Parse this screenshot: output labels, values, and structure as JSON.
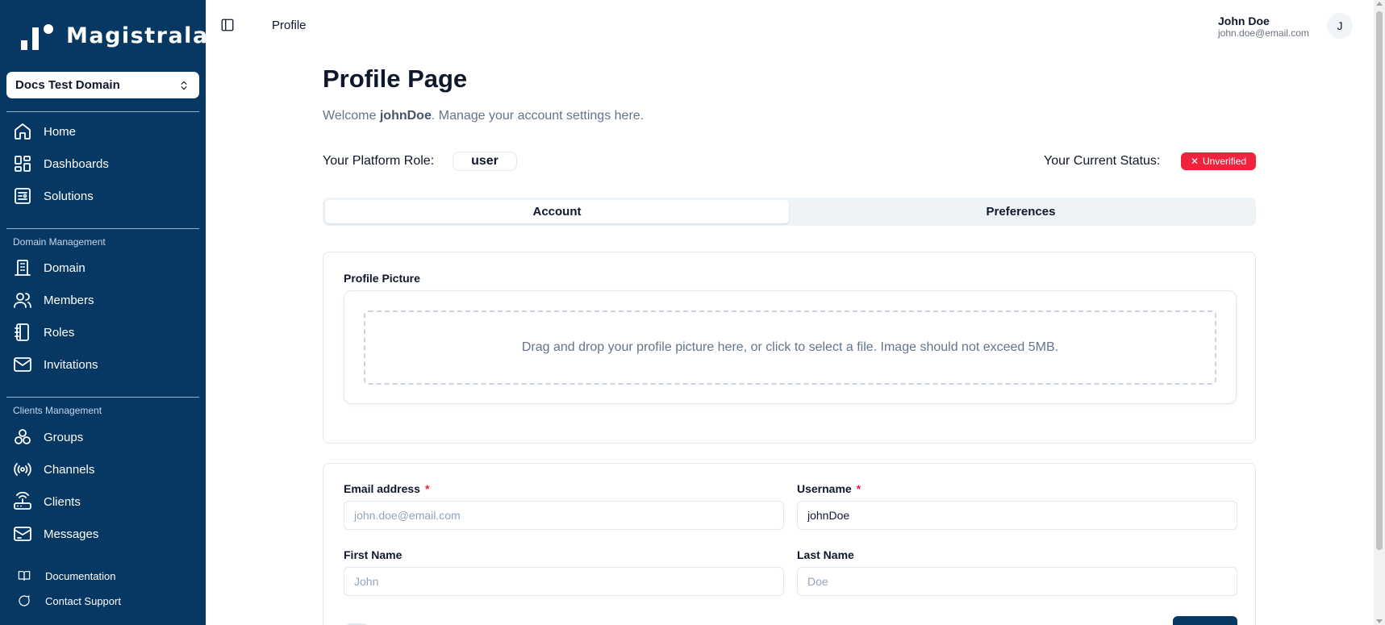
{
  "brand": {
    "name": "Magistrala"
  },
  "domain_selector": {
    "value": "Docs Test Domain"
  },
  "nav": {
    "main": [
      {
        "label": "Home",
        "icon": "home-icon"
      },
      {
        "label": "Dashboards",
        "icon": "dashboard-icon"
      },
      {
        "label": "Solutions",
        "icon": "solutions-icon"
      }
    ],
    "domain_section": "Domain Management",
    "domain": [
      {
        "label": "Domain",
        "icon": "domain-icon"
      },
      {
        "label": "Members",
        "icon": "members-icon"
      },
      {
        "label": "Roles",
        "icon": "roles-icon"
      },
      {
        "label": "Invitations",
        "icon": "mail-icon"
      }
    ],
    "clients_section": "Clients Management",
    "clients": [
      {
        "label": "Groups",
        "icon": "groups-icon"
      },
      {
        "label": "Channels",
        "icon": "channels-icon"
      },
      {
        "label": "Clients",
        "icon": "router-icon"
      },
      {
        "label": "Messages",
        "icon": "messages-icon"
      }
    ],
    "footer": [
      {
        "label": "Documentation",
        "icon": "book-icon"
      },
      {
        "label": "Contact Support",
        "icon": "chat-icon"
      }
    ]
  },
  "topbar": {
    "breadcrumb": "Profile",
    "user_name": "John Doe",
    "user_email": "john.doe@email.com",
    "avatar_initial": "J"
  },
  "profile": {
    "title": "Profile Page",
    "welcome_prefix": "Welcome ",
    "welcome_user": "johnDoe",
    "welcome_suffix": ". Manage your account settings here.",
    "role_label": "Your Platform Role:",
    "role_value": "user",
    "status_label": "Your Current Status:",
    "status_value": "Unverified",
    "status_color": "#ef233c"
  },
  "tabs": [
    {
      "label": "Account",
      "active": true
    },
    {
      "label": "Preferences",
      "active": false
    }
  ],
  "picture": {
    "label": "Profile Picture",
    "drop_text": "Drag and drop your profile picture here, or click to select a file. Image should not exceed 5MB."
  },
  "form": {
    "email_label": "Email address",
    "email_placeholder": "john.doe@email.com",
    "email_value": "",
    "username_label": "Username",
    "username_value": "johnDoe",
    "required_mark": "*",
    "first_name_label": "First Name",
    "first_name_placeholder": "John",
    "last_name_label": "Last Name",
    "last_name_placeholder": "Doe"
  },
  "colors": {
    "sidebar_bg": "#073763",
    "accent": "#073763",
    "danger": "#ef233c"
  }
}
